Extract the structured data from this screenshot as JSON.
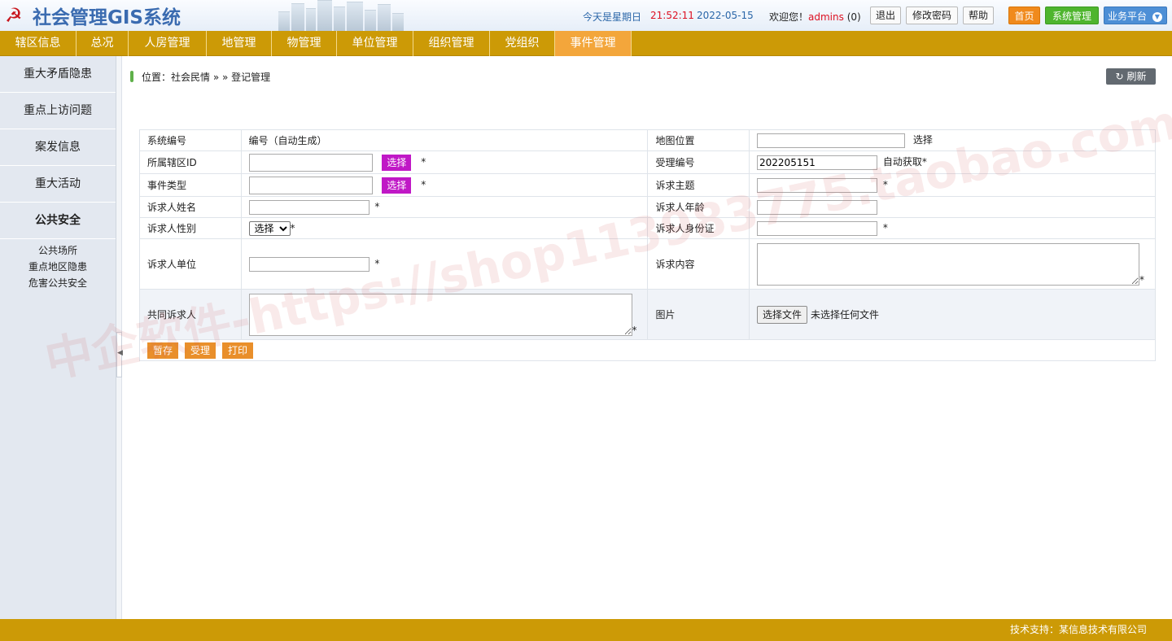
{
  "header": {
    "app_title": "社会管理GIS系统",
    "date_label": "今天是星期日",
    "time": "21:52:11",
    "date": "2022-05-15",
    "welcome": "欢迎您！",
    "user": "admins",
    "count": "(0)",
    "logout": "退出",
    "change_password": "修改密码",
    "help": "帮助",
    "home": "首页",
    "system_manage": "系统管理",
    "business_platform": "业务平台"
  },
  "nav": {
    "items": [
      {
        "label": "辖区信息"
      },
      {
        "label": "总况"
      },
      {
        "label": "人房管理"
      },
      {
        "label": "地管理"
      },
      {
        "label": "物管理"
      },
      {
        "label": "单位管理"
      },
      {
        "label": "组织管理"
      },
      {
        "label": "党组织"
      },
      {
        "label": "事件管理"
      }
    ],
    "active": "事件管理"
  },
  "sidebar": {
    "items": [
      {
        "label": "重大矛盾隐患"
      },
      {
        "label": "重点上访问题"
      },
      {
        "label": "案发信息"
      },
      {
        "label": "重大活动"
      },
      {
        "label": "公共安全"
      }
    ],
    "subitems": [
      {
        "label": "公共场所"
      },
      {
        "label": "重点地区隐患"
      },
      {
        "label": "危害公共安全"
      }
    ]
  },
  "breadcrumb": {
    "text": "位置：社会民情 » » 登记管理"
  },
  "refresh_label": "刷新",
  "form": {
    "system_no_label": "系统编号",
    "system_no_value": "编号（自动生成）",
    "map_pos_label": "地图位置",
    "map_select": "选择",
    "district_label": "所属辖区ID",
    "select_btn": "选择",
    "accept_no_label": "受理编号",
    "accept_no_value": "202205151",
    "auto_get": "自动获取*",
    "event_type_label": "事件类型",
    "subject_label": "诉求主题",
    "name_label": "诉求人姓名",
    "age_label": "诉求人年龄",
    "gender_label": "诉求人性别",
    "gender_option": "选择",
    "idcard_label": "诉求人身份证",
    "unit_label": "诉求人单位",
    "content_label": "诉求内容",
    "co_label": "共同诉求人",
    "picture_label": "图片",
    "file_btn": "选择文件",
    "file_status": "未选择任何文件",
    "star": "*",
    "btn_save": "暂存",
    "btn_accept": "受理",
    "btn_print": "打印"
  },
  "watermark": "中企软件-https://shop113983775.taobao.com",
  "footer": {
    "text": "技术支持：某信息技术有限公司"
  },
  "colors": {
    "nav_bg": "#cc9a06",
    "nav_active": "#f3a63b",
    "purple_btn": "#c018c6",
    "orange_btn": "#e98f2b"
  }
}
